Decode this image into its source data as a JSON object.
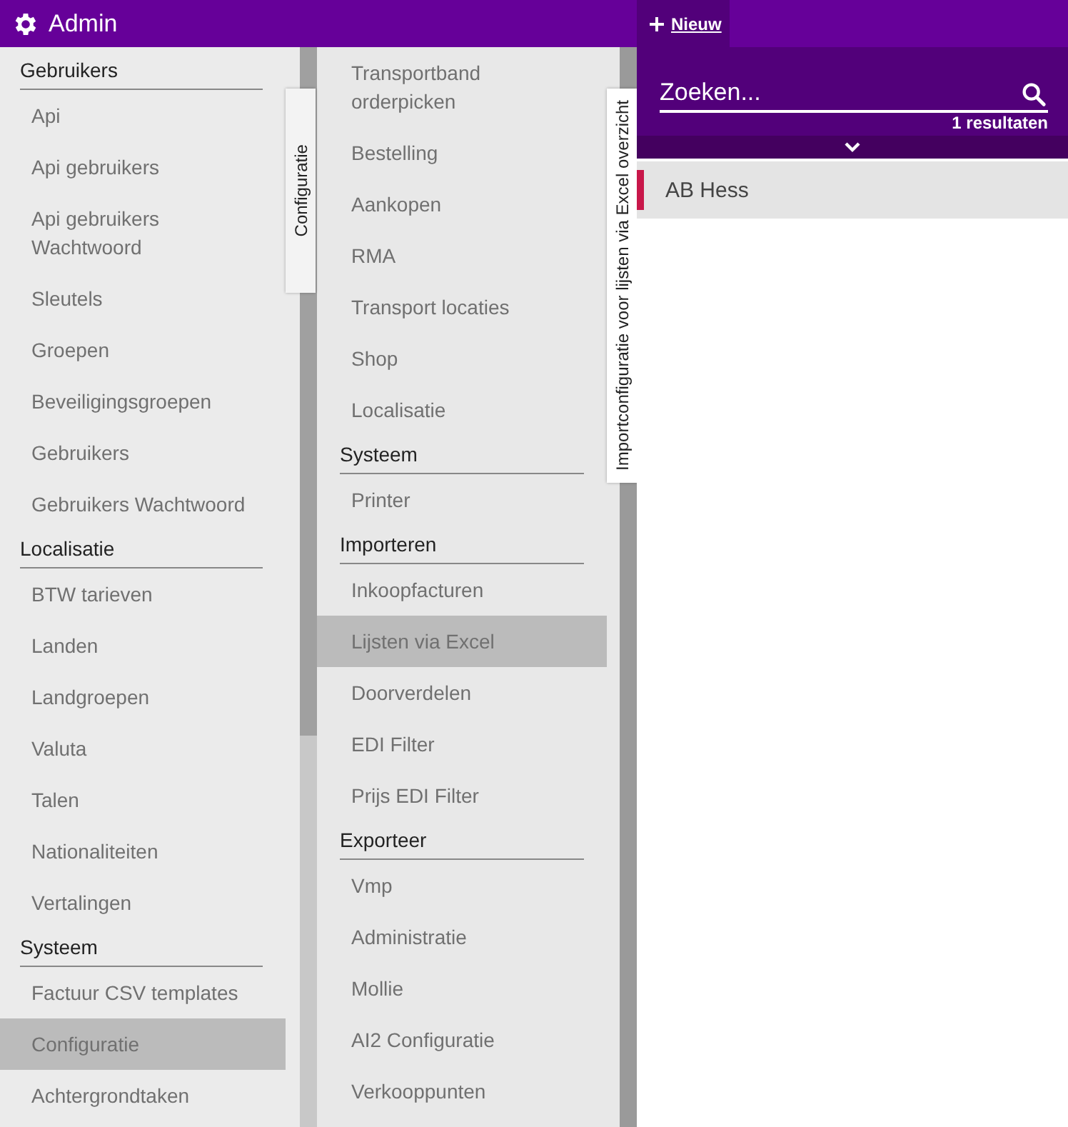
{
  "header": {
    "title": "Admin",
    "new_button": "Nieuw"
  },
  "menu": [
    {
      "heading": "Gebruikers",
      "items": [
        {
          "label": "Api",
          "selected": false
        },
        {
          "label": "Api gebruikers",
          "selected": false
        },
        {
          "label": "Api gebruikers Wachtwoord",
          "selected": false
        },
        {
          "label": "Sleutels",
          "selected": false
        },
        {
          "label": "Groepen",
          "selected": false
        },
        {
          "label": "Beveiligingsgroepen",
          "selected": false
        },
        {
          "label": "Gebruikers",
          "selected": false
        },
        {
          "label": "Gebruikers Wachtwoord",
          "selected": false
        }
      ]
    },
    {
      "heading": "Localisatie",
      "items": [
        {
          "label": "BTW tarieven",
          "selected": false
        },
        {
          "label": "Landen",
          "selected": false
        },
        {
          "label": "Landgroepen",
          "selected": false
        },
        {
          "label": "Valuta",
          "selected": false
        },
        {
          "label": "Talen",
          "selected": false
        },
        {
          "label": "Nationaliteiten",
          "selected": false
        },
        {
          "label": "Vertalingen",
          "selected": false
        }
      ]
    },
    {
      "heading": "Systeem",
      "items": [
        {
          "label": "Factuur CSV templates",
          "selected": false
        },
        {
          "label": "Configuratie",
          "selected": true
        },
        {
          "label": "Achtergrondtaken",
          "selected": false
        }
      ]
    }
  ],
  "menu_tab": "Configuratie",
  "submenu": [
    {
      "items": [
        {
          "label": "Transportband orderpicken",
          "selected": false
        },
        {
          "label": "Bestelling",
          "selected": false
        },
        {
          "label": "Aankopen",
          "selected": false
        },
        {
          "label": "RMA",
          "selected": false
        },
        {
          "label": "Transport locaties",
          "selected": false
        },
        {
          "label": "Shop",
          "selected": false
        },
        {
          "label": "Localisatie",
          "selected": false
        }
      ]
    },
    {
      "heading": "Systeem",
      "items": [
        {
          "label": "Printer",
          "selected": false
        }
      ]
    },
    {
      "heading": "Importeren",
      "items": [
        {
          "label": "Inkoopfacturen",
          "selected": false
        },
        {
          "label": "Lijsten via Excel",
          "selected": true
        },
        {
          "label": "Doorverdelen",
          "selected": false
        },
        {
          "label": "EDI Filter",
          "selected": false
        },
        {
          "label": "Prijs EDI Filter",
          "selected": false
        }
      ]
    },
    {
      "heading": "Exporteer",
      "items": [
        {
          "label": "Vmp",
          "selected": false
        },
        {
          "label": "Administratie",
          "selected": false
        },
        {
          "label": "Mollie",
          "selected": false
        },
        {
          "label": "AI2 Configuratie",
          "selected": false
        },
        {
          "label": "Verkooppunten",
          "selected": false
        }
      ]
    }
  ],
  "submenu_tab": "Importconfiguratie voor lijsten via Excel overzicht",
  "search": {
    "placeholder": "Zoeken...",
    "count": "1 resultaten"
  },
  "results": [
    {
      "name": "AB Hess",
      "color": "#c8174a"
    }
  ]
}
